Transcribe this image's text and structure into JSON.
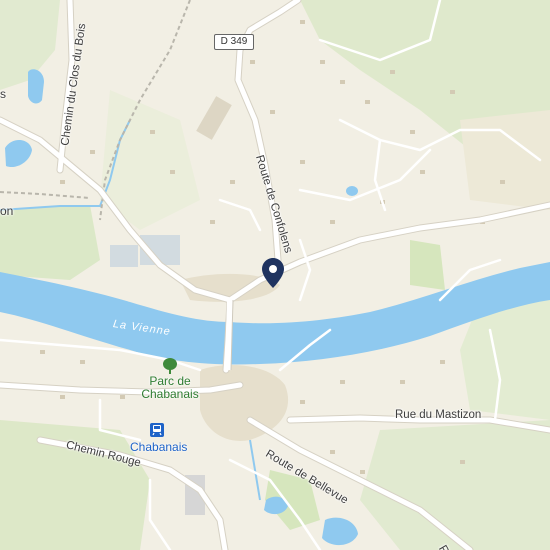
{
  "map": {
    "river_name": "La Vienne",
    "road_shield": "D 349",
    "streets": {
      "route_confolens": "Route de Confolens",
      "chemin_clos_bois": "Chemin du Clos du Bois",
      "rue_mastizon": "Rue du Mastizon",
      "chemin_rouge": "Chemin Rouge",
      "route_bellevue": "Route de Bellevue",
      "partial_left_top": "s",
      "partial_left_mid": "on",
      "partial_bottom_right": "Ro"
    },
    "poi": {
      "park_line1": "Parc de",
      "park_line2": "Chabanais",
      "station_name": "Chabanais"
    },
    "icons": [
      "map-pin-icon",
      "tree-icon",
      "train-station-icon"
    ],
    "colors": {
      "land": "#f2efe4",
      "water": "#8fc9ef",
      "green": "#d9e8c2",
      "road": "#ffffff",
      "pin": "#1f3360",
      "park_text": "#2f7d32",
      "station": "#1e63c8"
    }
  }
}
